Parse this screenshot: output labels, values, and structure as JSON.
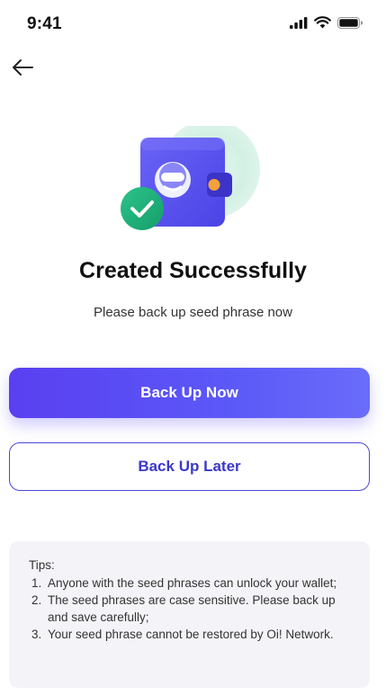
{
  "status_bar": {
    "time": "9:41",
    "icons": [
      "cellular-signal-icon",
      "wifi-icon",
      "battery-icon"
    ]
  },
  "nav": {
    "back_icon": "arrow-left-icon"
  },
  "hero": {
    "illustration": "wallet-with-checkmark-icon",
    "colors": {
      "wallet": "#5b55f0",
      "check_badge": "#1fb27a",
      "glow": "#cfeee0"
    }
  },
  "main": {
    "title": "Created Successfully",
    "subtitle": "Please back up seed phrase now"
  },
  "actions": {
    "primary_label": "Back Up Now",
    "secondary_label": "Back Up Later"
  },
  "tips": {
    "title": "Tips:",
    "items": [
      {
        "number": "1.",
        "text": "Anyone with the seed phrases can unlock your wallet;"
      },
      {
        "number": "2.",
        "text": "The seed phrases are case sensitive. Please back up and save carefully;"
      },
      {
        "number": "3.",
        "text": "Your seed phrase cannot be restored by Oi! Network."
      }
    ]
  },
  "colors": {
    "accent": "#5a4af2",
    "accent_text": "#3b39c9",
    "tips_bg": "#f4f4f8"
  }
}
